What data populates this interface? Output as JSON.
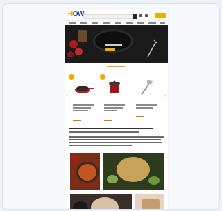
{
  "site": {
    "logo_parts": [
      "H",
      "O",
      "W"
    ],
    "brand_color": "#f2a900",
    "logo_color": "#2a3f8f"
  },
  "header": {
    "icons": [
      "search-icon",
      "heart-icon",
      "user-icon",
      "cart-icon"
    ]
  },
  "hero": {
    "background": "#1a1a1a"
  },
  "products": [
    {
      "image": "red-skillet",
      "badge": true
    },
    {
      "image": "red-cast-iron-cocotte",
      "badge": true
    },
    {
      "image": "silver-pasta-server",
      "badge": false
    }
  ],
  "gallery": [
    "red-dish-photo",
    "roast-chicken-photo",
    "pan-cooking-photo",
    "food-prep-photo",
    "dish-photo"
  ]
}
